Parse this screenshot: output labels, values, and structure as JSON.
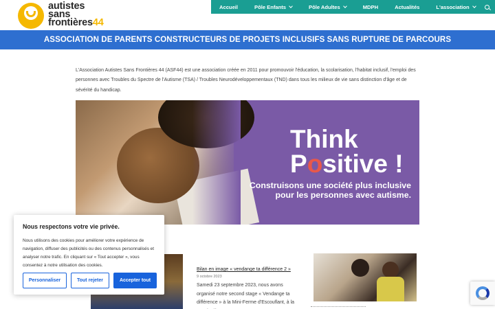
{
  "logo": {
    "line1": "autistes",
    "line2": "sans",
    "line3": "frontières",
    "number": "44",
    "icon": "smiley-logo-icon",
    "color": "#f5b800"
  },
  "nav": {
    "items": [
      {
        "label": "Accueil",
        "dropdown": false
      },
      {
        "label": "Pôle Enfants",
        "dropdown": true
      },
      {
        "label": "Pôle Adultes",
        "dropdown": true
      },
      {
        "label": "MDPH",
        "dropdown": false
      },
      {
        "label": "Actualités",
        "dropdown": false
      },
      {
        "label": "L'association",
        "dropdown": true
      }
    ],
    "search_icon": "search-icon",
    "color": "#1a9e93"
  },
  "banner": {
    "text": "ASSOCIATION DE PARENTS CONSTRUCTEURS DE PROJETS INCLUSIFS SANS RUPTURE DE PARCOURS",
    "color": "#2e6fd0"
  },
  "intro": {
    "text": "L'Association Autistes Sans Frontières 44 (ASF44) est une association créée en 2011 pour promouvoir l'éducation, la scolarisation, l'habitat inclusif, l'emploi des personnes avec Troubles du Spectre de l'Autisme (TSA) / Troubles Neurodéveloppementaux (TND) dans tous les milieux de vie sans distinction d'âge et de sévérité du handicap."
  },
  "hero": {
    "think": "Think",
    "positive_p": "P",
    "positive_o": "o",
    "positive_rest": "sitive !",
    "slogan_line1": "Construisons une société plus inclusive",
    "slogan_line2": "pour les personnes avec autisme.",
    "color": "#7a5aa6"
  },
  "post": {
    "title": "Bilan en image « vendange ta différence 2 »",
    "date": "9 octobre 2023",
    "excerpt": "Samedi 23 septembre 2023, nous avons organisé notre second stage « Vendange ta différence » à la Mini-Ferme d'Escouflant, à la Regrippière"
  },
  "cookie": {
    "title": "Nous respectons votre vie privée.",
    "text": "Nous utilisons des cookies pour améliorer votre expérience de navigation, diffuser des publicités ou des contenus personnalisés et analyser notre trafic. En cliquant sur « Tout accepter », vous consentez à notre utilisation des cookies.",
    "btn_customize": "Personnaliser",
    "btn_reject": "Tout rejeter",
    "btn_accept": "Accepter tout",
    "accent": "#1863dc"
  }
}
